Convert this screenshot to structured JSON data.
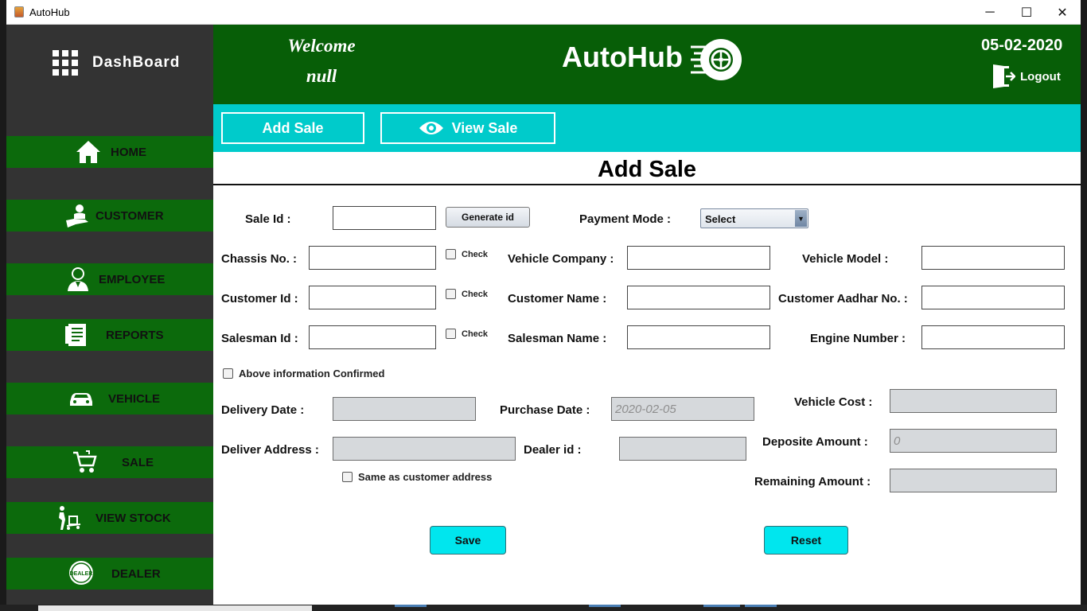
{
  "window": {
    "title": "AutoHub",
    "minimize": "─",
    "maximize": "☐",
    "close": "✕"
  },
  "sidebar": {
    "dashboard": "DashBoard",
    "items": [
      {
        "label": "HOME",
        "icon": "home-icon"
      },
      {
        "label": "CUSTOMER",
        "icon": "customer-icon"
      },
      {
        "label": "EMPLOYEE",
        "icon": "employee-icon"
      },
      {
        "label": "REPORTS",
        "icon": "reports-icon"
      },
      {
        "label": "VEHICLE",
        "icon": "car-icon"
      },
      {
        "label": "SALE",
        "icon": "cart-icon"
      },
      {
        "label": "VIEW STOCK",
        "icon": "stock-icon"
      },
      {
        "label": "DEALER",
        "icon": "dealer-icon"
      }
    ],
    "dealer_badge": "DEALER"
  },
  "header": {
    "welcome": "Welcome",
    "user": "null",
    "brand": "AutoHub",
    "date": "05-02-2020",
    "logout": "Logout"
  },
  "tabs": {
    "add_sale": "Add Sale",
    "view_sale": "View Sale"
  },
  "form": {
    "title": "Add Sale",
    "sale_id": "Sale Id :",
    "generate_id": "Generate id",
    "payment_mode": "Payment Mode :",
    "payment_selected": "Select",
    "chassis_no": "Chassis No. :",
    "vehicle_company": "Vehicle Company :",
    "vehicle_model": "Vehicle Model :",
    "customer_id": "Customer Id :",
    "customer_name": "Customer Name :",
    "customer_aadhar": "Customer Aadhar No. :",
    "salesman_id": "Salesman Id :",
    "salesman_name": "Salesman Name :",
    "engine_number": "Engine Number :",
    "check": "Check",
    "confirmed": "Above information Confirmed",
    "delivery_date": "Delivery Date :",
    "purchase_date": "Purchase Date :",
    "purchase_date_value": "2020-02-05",
    "vehicle_cost": "Vehicle Cost :",
    "deliver_address": "Deliver Address :",
    "dealer_id": "Dealer  id :",
    "deposite_amount": "Deposite Amount :",
    "deposite_value": "0",
    "same_as_customer": "Same as customer address",
    "remaining_amount": "Remaining Amount :",
    "save": "Save",
    "reset": "Reset"
  },
  "colors": {
    "sidebar_bg": "#333333",
    "nav_green": "#0c6a0c",
    "header_green": "#075e07",
    "tabbar_cyan": "#00cbcb",
    "button_cyan": "#00e6ee"
  }
}
